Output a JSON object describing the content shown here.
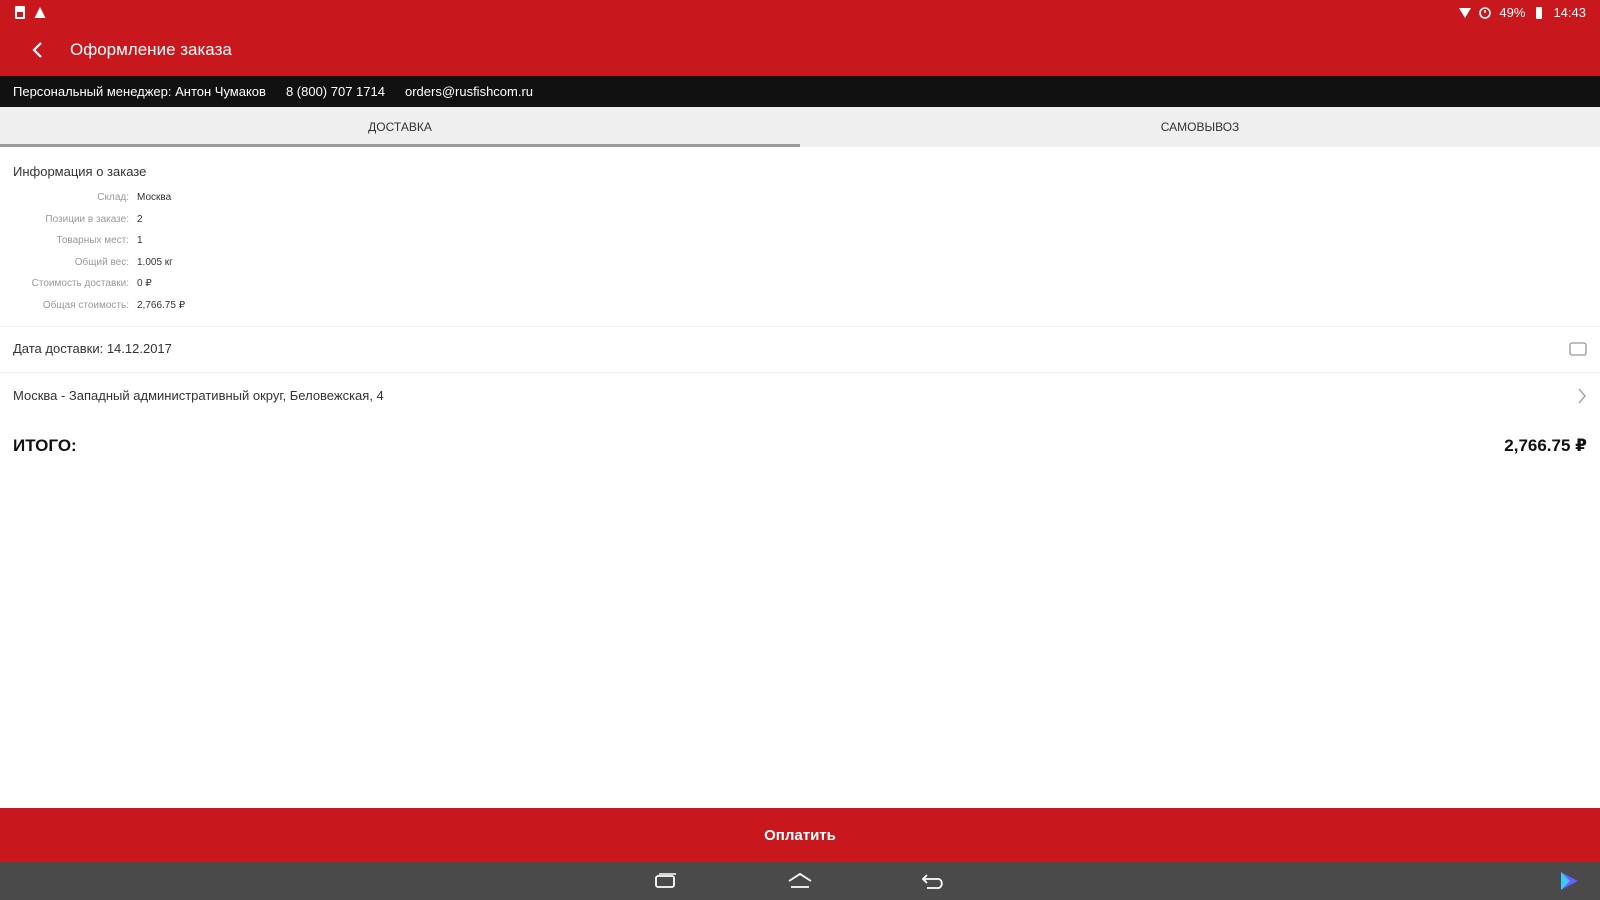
{
  "status_bar": {
    "battery": "49%",
    "time": "14:43"
  },
  "app_bar": {
    "title": "Оформление заказа"
  },
  "manager_bar": {
    "manager": "Персональный менеджер: Антон Чумаков",
    "phone": "8 (800) 707 1714",
    "email": "orders@rusfishcom.ru"
  },
  "tabs": [
    {
      "label": "Доставка",
      "active": true
    },
    {
      "label": "Самовывоз",
      "active": false
    }
  ],
  "order_info": {
    "title": "Информация о заказе",
    "rows": [
      {
        "label": "Склад:",
        "value": "Москва"
      },
      {
        "label": "Позиции в заказе:",
        "value": "2"
      },
      {
        "label": "Товарных мест:",
        "value": "1"
      },
      {
        "label": "Общий вес:",
        "value": "1.005 кг"
      },
      {
        "label": "Стоимость доставки:",
        "value": "0 ₽"
      },
      {
        "label": "Общая стоимость:",
        "value": "2,766.75 ₽"
      }
    ]
  },
  "delivery": {
    "date_text": "Дата доставки: 14.12.2017",
    "address_text": "Москва - Западный административный округ, Беловежская, 4"
  },
  "total": {
    "label": "ИТОГО:",
    "value": "2,766.75 ₽"
  },
  "pay_button": {
    "label": "Оплатить"
  },
  "colors": {
    "brand_red": "#c8181e",
    "manager_bar": "#111111",
    "nav_bar": "#4a4a4a"
  }
}
